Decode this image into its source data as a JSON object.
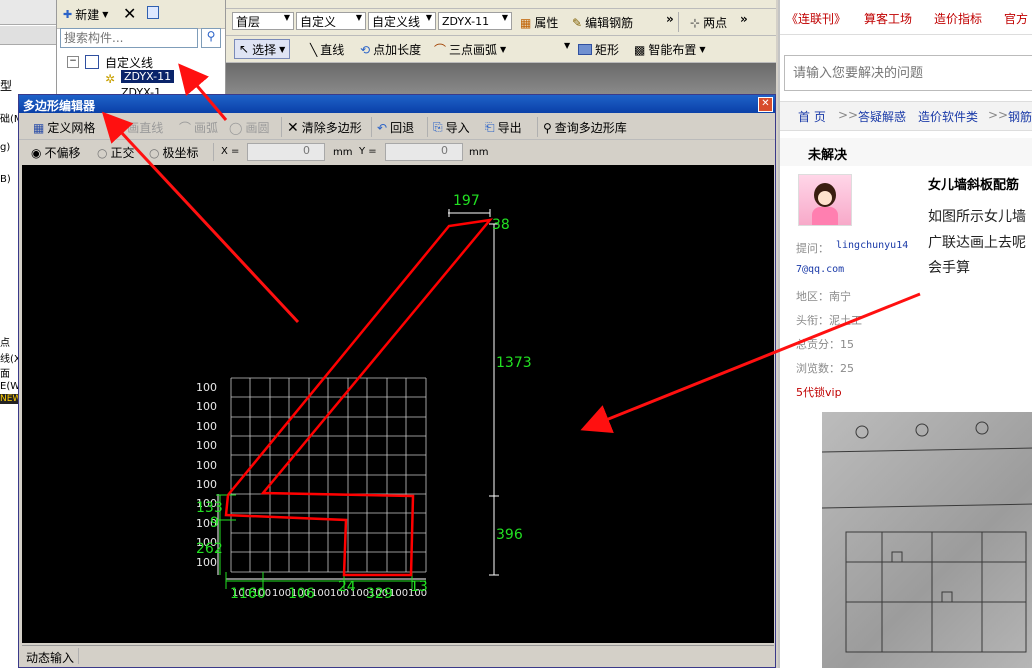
{
  "left_pane": {
    "items": [
      "型",
      "础(M",
      "g)",
      "B)",
      "点",
      "线(X)",
      "面",
      "E(W)",
      "NEW"
    ]
  },
  "component_panel": {
    "new_label": "新建",
    "search_placeholder": "搜索构件...",
    "tree_root": "自定义线",
    "tree_selected": "ZDYX-11",
    "tree_next": "ZDYX-1"
  },
  "main_toolbar": {
    "floor": "首层",
    "category": "自定义",
    "subcategory": "自定义线",
    "component": "ZDYX-11",
    "property_label": "属性",
    "edit_rebar_label": "编辑钢筋",
    "two_point_label": "两点",
    "select_label": "选择",
    "line_label": "直线",
    "point_length_label": "点加长度",
    "three_point_arc_label": "三点画弧",
    "rect_label": "矩形",
    "smart_layout_label": "智能布置"
  },
  "editor": {
    "title": "多边形编辑器",
    "toolbar": {
      "define_grid": "定义网格",
      "draw_line": "画直线",
      "draw_arc": "画弧",
      "draw_circle": "画圆",
      "clear_polygon": "清除多边形",
      "undo": "回退",
      "import": "导入",
      "export": "导出",
      "query_library": "查询多边形库"
    },
    "options": {
      "no_offset": "不偏移",
      "orthogonal": "正交",
      "polar": "极坐标",
      "x_label": "X =",
      "x_value": "0",
      "x_unit": "mm",
      "y_label": "Y =",
      "y_value": "0",
      "y_unit": "mm"
    },
    "dimensions": {
      "top_width": "197",
      "top_right": "38",
      "right_tall": "1373",
      "right_short": "396",
      "left_a": "133",
      "left_b": "9",
      "left_c": "262",
      "bottom_a": "116",
      "bottom_b": "60",
      "bottom_c": "106",
      "bottom_d": "24",
      "bottom_e": "329",
      "bottom_f": "13"
    },
    "grid_left_labels": [
      "100",
      "100",
      "100",
      "100",
      "100",
      "100",
      "100",
      "100",
      "100",
      "100"
    ],
    "grid_bottom_labels": [
      "100",
      "100",
      "100",
      "100",
      "100",
      "100",
      "100",
      "100",
      "100",
      "100"
    ],
    "status": "动态输入"
  },
  "web": {
    "nav": [
      "《连联刊》",
      "算客工场",
      "造价指标",
      "官方"
    ],
    "search_placeholder": "请输入您要解决的问题",
    "breadcrumb": [
      "首 页",
      "答疑解惑",
      "造价软件类",
      "钢筋"
    ],
    "status_title": "未解决",
    "question_title": "女儿墙斜板配筋",
    "question_body_1": "如图所示女儿墙",
    "question_body_2": "广联达画上去呢",
    "question_body_3": "会手算",
    "asker_label": "提问：",
    "asker_name": "lingchunyu14",
    "asker_email": "7@qq.com",
    "region": "地区：南宁",
    "title_rank": "头衔：泥土工",
    "points": "总贡分：15",
    "views": "浏览数：25",
    "vip": "5代锁vip"
  },
  "colors": {
    "accent_blue": "#1f5fc6",
    "polygon_red": "#ff0000",
    "dim_green": "#22e022"
  }
}
